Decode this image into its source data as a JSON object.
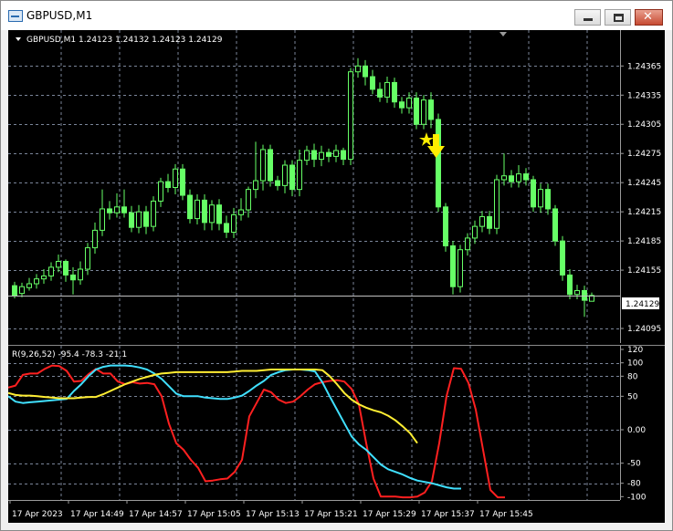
{
  "window": {
    "title": "GBPUSD,M1"
  },
  "chart": {
    "header": "GBPUSD,M1  1.24123 1.24132 1.24123 1.24129",
    "current_price_label": "1.24129",
    "indicator_label": "R(9,26,52) -95.4 -78.3 -21.1",
    "colors": {
      "background": "#000000",
      "bull": "#66ff66",
      "grid": "#7a8599",
      "red": "#ff2020",
      "cyan": "#40e0ff",
      "yellow": "#ffee33",
      "arrow": "#ffee00"
    },
    "icons": [
      "triangle-down-icon",
      "star-icon",
      "down-arrow-icon"
    ]
  },
  "chart_data": [
    {
      "type": "candlestick",
      "price_ticks": [
        "1.24365",
        "1.24335",
        "1.24305",
        "1.24275",
        "1.24245",
        "1.24215",
        "1.24185",
        "1.24155",
        "1.24095"
      ],
      "time_ticks": [
        "17 Apr 2023",
        "17 Apr 14:49",
        "17 Apr 14:57",
        "17 Apr 15:05",
        "17 Apr 15:13",
        "17 Apr 15:21",
        "17 Apr 15:29",
        "17 Apr 15:37",
        "17 Apr 15:45"
      ],
      "ylim": [
        1.2408,
        1.24385
      ],
      "current_price": 1.24129,
      "candles": [
        [
          1.24139,
          1.24129,
          1.24143,
          1.24126
        ],
        [
          1.24131,
          1.24138,
          1.24142,
          1.24127
        ],
        [
          1.24137,
          1.24141,
          1.24147,
          1.24134
        ],
        [
          1.24141,
          1.24146,
          1.24151,
          1.24136
        ],
        [
          1.24146,
          1.24149,
          1.24156,
          1.24141
        ],
        [
          1.24149,
          1.24158,
          1.24163,
          1.24144
        ],
        [
          1.24158,
          1.24164,
          1.24171,
          1.24153
        ],
        [
          1.24164,
          1.2415,
          1.24166,
          1.24143
        ],
        [
          1.2415,
          1.24145,
          1.24158,
          1.2413
        ],
        [
          1.24145,
          1.24156,
          1.24164,
          1.2414
        ],
        [
          1.24156,
          1.24178,
          1.24183,
          1.2415
        ],
        [
          1.24178,
          1.24196,
          1.24204,
          1.24172
        ],
        [
          1.24196,
          1.24218,
          1.24238,
          1.2419
        ],
        [
          1.24218,
          1.24214,
          1.24226,
          1.24207
        ],
        [
          1.24214,
          1.2422,
          1.24234,
          1.24209
        ],
        [
          1.2422,
          1.24214,
          1.24238,
          1.24209
        ],
        [
          1.24214,
          1.24199,
          1.24221,
          1.24194
        ],
        [
          1.24199,
          1.24215,
          1.24222,
          1.24193
        ],
        [
          1.24215,
          1.242,
          1.24221,
          1.24192
        ],
        [
          1.242,
          1.24226,
          1.24231,
          1.24195
        ],
        [
          1.24226,
          1.24246,
          1.2425,
          1.2422
        ],
        [
          1.24246,
          1.2424,
          1.24254,
          1.24235
        ],
        [
          1.2424,
          1.24259,
          1.24264,
          1.24233
        ],
        [
          1.24259,
          1.24232,
          1.24264,
          1.24227
        ],
        [
          1.24232,
          1.24208,
          1.24238,
          1.24203
        ],
        [
          1.24208,
          1.24227,
          1.24233,
          1.24202
        ],
        [
          1.24227,
          1.24204,
          1.24233,
          1.24196
        ],
        [
          1.24204,
          1.24222,
          1.24227,
          1.24196
        ],
        [
          1.24222,
          1.24203,
          1.24228,
          1.24196
        ],
        [
          1.24203,
          1.24194,
          1.24211,
          1.24188
        ],
        [
          1.24194,
          1.24212,
          1.24219,
          1.24188
        ],
        [
          1.24212,
          1.24217,
          1.24229,
          1.24206
        ],
        [
          1.24217,
          1.24238,
          1.24241,
          1.24209
        ],
        [
          1.24238,
          1.24247,
          1.24287,
          1.24229
        ],
        [
          1.24247,
          1.24279,
          1.24284,
          1.24237
        ],
        [
          1.24279,
          1.24247,
          1.24284,
          1.24241
        ],
        [
          1.24247,
          1.24242,
          1.24252,
          1.24237
        ],
        [
          1.24242,
          1.24263,
          1.24268,
          1.24234
        ],
        [
          1.24263,
          1.24238,
          1.24268,
          1.24231
        ],
        [
          1.24238,
          1.24268,
          1.24279,
          1.24231
        ],
        [
          1.24268,
          1.24278,
          1.24283,
          1.24263
        ],
        [
          1.24278,
          1.24269,
          1.24285,
          1.24261
        ],
        [
          1.24269,
          1.24276,
          1.24283,
          1.24262
        ],
        [
          1.24276,
          1.24272,
          1.2428,
          1.24266
        ],
        [
          1.24272,
          1.24278,
          1.24284,
          1.24266
        ],
        [
          1.24278,
          1.24269,
          1.24281,
          1.24263
        ],
        [
          1.24269,
          1.24359,
          1.24363,
          1.24263
        ],
        [
          1.24359,
          1.24365,
          1.24373,
          1.24353
        ],
        [
          1.24365,
          1.24354,
          1.24371,
          1.24345
        ],
        [
          1.24354,
          1.24341,
          1.24361,
          1.24336
        ],
        [
          1.24341,
          1.24333,
          1.24348,
          1.24328
        ],
        [
          1.24333,
          1.24348,
          1.24354,
          1.24327
        ],
        [
          1.24348,
          1.24328,
          1.24353,
          1.24322
        ],
        [
          1.24328,
          1.24322,
          1.24333,
          1.24316
        ],
        [
          1.24322,
          1.24332,
          1.24338,
          1.24316
        ],
        [
          1.24332,
          1.24305,
          1.24338,
          1.243
        ],
        [
          1.24305,
          1.2433,
          1.24335,
          1.243
        ],
        [
          1.2433,
          1.2431,
          1.24338,
          1.24301
        ],
        [
          1.2431,
          1.2422,
          1.24316,
          1.24215
        ],
        [
          1.2422,
          1.2418,
          1.24224,
          1.24174
        ],
        [
          1.2418,
          1.24138,
          1.24185,
          1.2413
        ],
        [
          1.24138,
          1.24176,
          1.24181,
          1.24132
        ],
        [
          1.24176,
          1.24188,
          1.24193,
          1.2417
        ],
        [
          1.24188,
          1.242,
          1.24206,
          1.24182
        ],
        [
          1.242,
          1.2421,
          1.24216,
          1.24194
        ],
        [
          1.2421,
          1.24198,
          1.24216,
          1.24192
        ],
        [
          1.24198,
          1.24248,
          1.24253,
          1.24192
        ],
        [
          1.24248,
          1.24252,
          1.24275,
          1.24242
        ],
        [
          1.24252,
          1.24246,
          1.24258,
          1.2424
        ],
        [
          1.24246,
          1.24254,
          1.24263,
          1.2424
        ],
        [
          1.24254,
          1.24248,
          1.2426,
          1.24242
        ],
        [
          1.24248,
          1.2422,
          1.24252,
          1.24215
        ],
        [
          1.2422,
          1.24238,
          1.24244,
          1.24214
        ],
        [
          1.24238,
          1.24218,
          1.24244,
          1.24212
        ],
        [
          1.24218,
          1.24185,
          1.24222,
          1.2418
        ],
        [
          1.24185,
          1.2415,
          1.2419,
          1.24144
        ],
        [
          1.2415,
          1.2413,
          1.24156,
          1.24125
        ],
        [
          1.2413,
          1.24134,
          1.2414,
          1.24125
        ],
        [
          1.24134,
          1.24124,
          1.24139,
          1.24107
        ],
        [
          1.24123,
          1.24129,
          1.24132,
          1.24123
        ]
      ]
    },
    {
      "type": "line",
      "y_ticks": [
        "120",
        "100",
        "80",
        "50",
        "0.00",
        "-50",
        "-80",
        "-100"
      ],
      "ylim": [
        -105,
        120
      ],
      "series": [
        {
          "color": "#ff2020",
          "values": [
            63,
            66,
            82,
            84,
            84,
            91,
            96,
            95,
            88,
            72,
            73,
            83,
            91,
            84,
            84,
            72,
            68,
            71,
            69,
            70,
            68,
            50,
            9,
            -20,
            -30,
            -45,
            -57,
            -77,
            -76,
            -74,
            -73,
            -63,
            -45,
            20,
            40,
            60,
            56,
            45,
            40,
            42,
            50,
            60,
            68,
            71,
            73,
            74,
            72,
            61,
            38,
            -20,
            -73,
            -100,
            -100,
            -100,
            -101,
            -101,
            -100,
            -94,
            -77,
            -20,
            50,
            92,
            91,
            70,
            30,
            -30,
            -90,
            -101,
            -101
          ]
        },
        {
          "color": "#40e0ff",
          "values": [
            50,
            42,
            40,
            41,
            42,
            43,
            44,
            45,
            46,
            58,
            68,
            80,
            90,
            94,
            96,
            96,
            96,
            95,
            93,
            90,
            84,
            76,
            65,
            54,
            50,
            50,
            50,
            48,
            47,
            46,
            46,
            48,
            51,
            58,
            66,
            73,
            82,
            86,
            89,
            90,
            90,
            89,
            87,
            71,
            50,
            30,
            10,
            -10,
            -22,
            -30,
            -41,
            -52,
            -59,
            -63,
            -67,
            -72,
            -76,
            -78,
            -80,
            -83,
            -86,
            -88,
            -88
          ]
        },
        {
          "color": "#ffee33",
          "values": [
            55,
            52,
            51,
            51,
            50,
            49,
            48,
            47,
            47,
            47,
            48,
            49,
            49,
            53,
            58,
            63,
            68,
            72,
            76,
            79,
            82,
            84,
            85,
            86,
            86,
            86,
            86,
            86,
            86,
            86,
            86,
            87,
            88,
            88,
            88,
            89,
            90,
            90,
            90,
            90,
            90,
            90,
            90,
            89,
            80,
            68,
            55,
            45,
            38,
            33,
            29,
            26,
            21,
            14,
            5,
            -5,
            -20
          ]
        }
      ]
    }
  ]
}
